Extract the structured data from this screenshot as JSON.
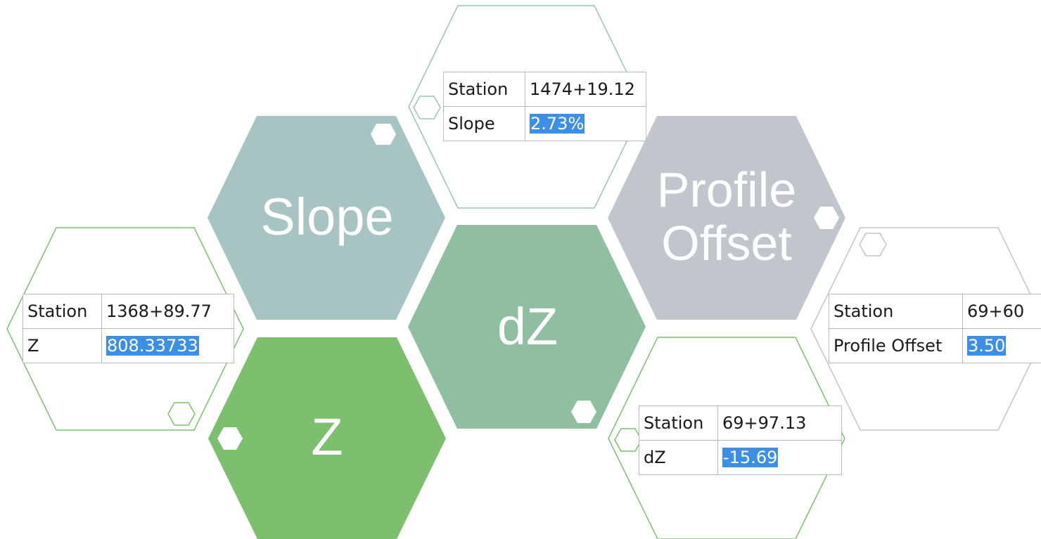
{
  "colors": {
    "slope_hex": "#a8c4c2",
    "dz_hex": "#8fbfa0",
    "z_hex": "#7cbf6f",
    "profile_offset_hex": "#c1c6cc",
    "outline_teal": "#9cc0bc",
    "outline_green": "#7cbf6f",
    "outline_gray": "#c5c5c5",
    "highlight": "#3d8fe6"
  },
  "hexagons": {
    "slope": {
      "label": "Slope"
    },
    "dz": {
      "label": "dZ"
    },
    "z": {
      "label": "Z"
    },
    "profile_offset": {
      "label_line1": "Profile",
      "label_line2": "Offset"
    }
  },
  "tables": {
    "slope": {
      "row1_label": "Station",
      "row1_value": "1474+19.12",
      "row2_label": "Slope",
      "row2_value": "2.73%"
    },
    "z": {
      "row1_label": "Station",
      "row1_value": "1368+89.77",
      "row2_label": "Z",
      "row2_value": "808.33733"
    },
    "dz": {
      "row1_label": "Station",
      "row1_value": "69+97.13",
      "row2_label": "dZ",
      "row2_value": "-15.69"
    },
    "profile_offset": {
      "row1_label": "Station",
      "row1_value": "69+60",
      "row2_label": "Profile Offset",
      "row2_value": "3.50"
    }
  }
}
